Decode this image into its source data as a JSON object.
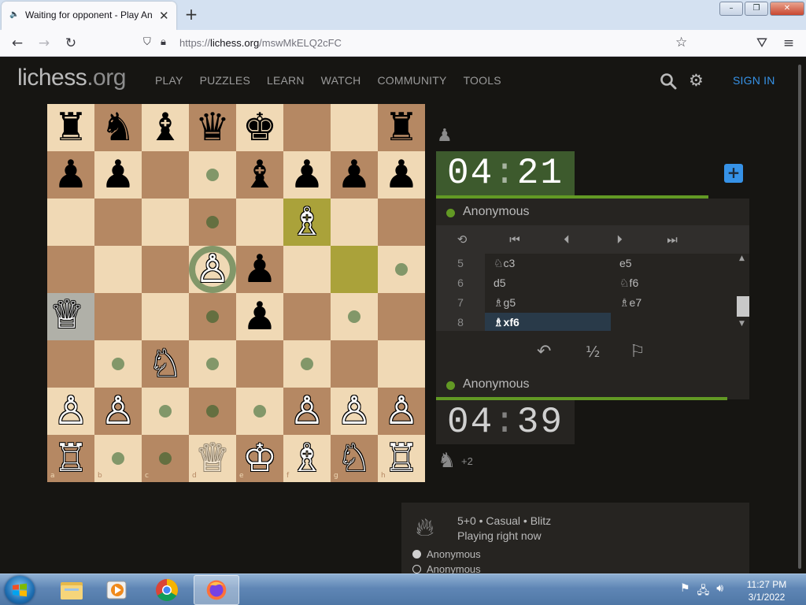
{
  "browser": {
    "tab_title": "Waiting for opponent - Play Anonymous",
    "tab_close": "✕",
    "new_tab": "+",
    "url_scheme": "https://",
    "url_host": "lichess.org",
    "url_path": "/mswMkELQ2cFC",
    "window_buttons": [
      "–",
      "❐",
      "✕"
    ]
  },
  "site": {
    "logo_main": "lichess",
    "logo_tld": ".org",
    "nav": [
      "PLAY",
      "PUZZLES",
      "LEARN",
      "WATCH",
      "COMMUNITY",
      "TOOLS"
    ],
    "signin": "SIGN IN"
  },
  "board": {
    "pieces": [
      {
        "sq": "a8",
        "p": "♜",
        "c": "b"
      },
      {
        "sq": "b8",
        "p": "♞",
        "c": "b"
      },
      {
        "sq": "c8",
        "p": "♝",
        "c": "b"
      },
      {
        "sq": "d8",
        "p": "♛",
        "c": "b"
      },
      {
        "sq": "e8",
        "p": "♚",
        "c": "b"
      },
      {
        "sq": "h8",
        "p": "♜",
        "c": "b"
      },
      {
        "sq": "a7",
        "p": "♟",
        "c": "b"
      },
      {
        "sq": "b7",
        "p": "♟",
        "c": "b"
      },
      {
        "sq": "e7",
        "p": "♝",
        "c": "b"
      },
      {
        "sq": "f7",
        "p": "♟",
        "c": "b"
      },
      {
        "sq": "g7",
        "p": "♟",
        "c": "b"
      },
      {
        "sq": "h7",
        "p": "♟",
        "c": "b"
      },
      {
        "sq": "f6",
        "p": "♗",
        "c": "w"
      },
      {
        "sq": "d5",
        "p": "♙",
        "c": "w"
      },
      {
        "sq": "e5",
        "p": "♟",
        "c": "b"
      },
      {
        "sq": "a4",
        "p": "♕",
        "c": "w"
      },
      {
        "sq": "e4",
        "p": "♟",
        "c": "b"
      },
      {
        "sq": "c3",
        "p": "♘",
        "c": "w"
      },
      {
        "sq": "a2",
        "p": "♙",
        "c": "w"
      },
      {
        "sq": "b2",
        "p": "♙",
        "c": "w"
      },
      {
        "sq": "f2",
        "p": "♙",
        "c": "w"
      },
      {
        "sq": "g2",
        "p": "♙",
        "c": "w"
      },
      {
        "sq": "h2",
        "p": "♙",
        "c": "w"
      },
      {
        "sq": "a1",
        "p": "♖",
        "c": "w"
      },
      {
        "sq": "e1",
        "p": "♔",
        "c": "w"
      },
      {
        "sq": "f1",
        "p": "♗",
        "c": "w"
      },
      {
        "sq": "g1",
        "p": "♘",
        "c": "w"
      },
      {
        "sq": "h1",
        "p": "♖",
        "c": "w"
      }
    ],
    "ghost_squares": [
      "d1"
    ],
    "lastmove_squares": [
      "g5",
      "f6"
    ],
    "dragged_from": [
      "a4"
    ],
    "move_dots": [
      "d7",
      "d6",
      "h5",
      "d4",
      "g4",
      "b3",
      "d3",
      "f3",
      "c2",
      "d2",
      "e2",
      "b1",
      "c1"
    ],
    "move_rings": [
      "d5"
    ],
    "ranks": [
      "8",
      "7",
      "6",
      "5",
      "4",
      "3",
      "2",
      "1"
    ],
    "files": [
      "a",
      "b",
      "c",
      "d",
      "e",
      "f",
      "g",
      "h"
    ]
  },
  "opponent": {
    "captured": "♟",
    "clock_min": "04",
    "clock_sep": ":",
    "clock_sec": "21",
    "timebar_fraction": 0.87,
    "name": "Anonymous"
  },
  "plus_label": "+",
  "controls": [
    "⟲",
    "⏮",
    "⏴",
    "⏵",
    "⏭"
  ],
  "moves": [
    {
      "n": "5",
      "w": "♘c3",
      "b": "e5"
    },
    {
      "n": "6",
      "w": "d5",
      "b": "♘f6"
    },
    {
      "n": "7",
      "w": "♗g5",
      "b": "♗e7"
    },
    {
      "n": "8",
      "w": "♗xf6",
      "b": ""
    }
  ],
  "active_move": "8w",
  "actions": [
    "↶",
    "½",
    "⚐"
  ],
  "player": {
    "name": "Anonymous",
    "clock_min": "04",
    "clock_sep": ":",
    "clock_sec": "39",
    "timebar_fraction": 0.93,
    "captured": "♞",
    "score": "+2"
  },
  "game_info": {
    "line1": "5+0 • Casual • Blitz",
    "line2": "Playing right now",
    "players": [
      "Anonymous",
      "Anonymous"
    ]
  },
  "taskbar": {
    "time": "11:27 PM",
    "date": "3/1/2022"
  },
  "colors": {
    "light_square": "#f0d9b5",
    "dark_square": "#b58863",
    "lastmove": "#cdd26a",
    "accent": "#3692e7",
    "online": "#629924"
  }
}
